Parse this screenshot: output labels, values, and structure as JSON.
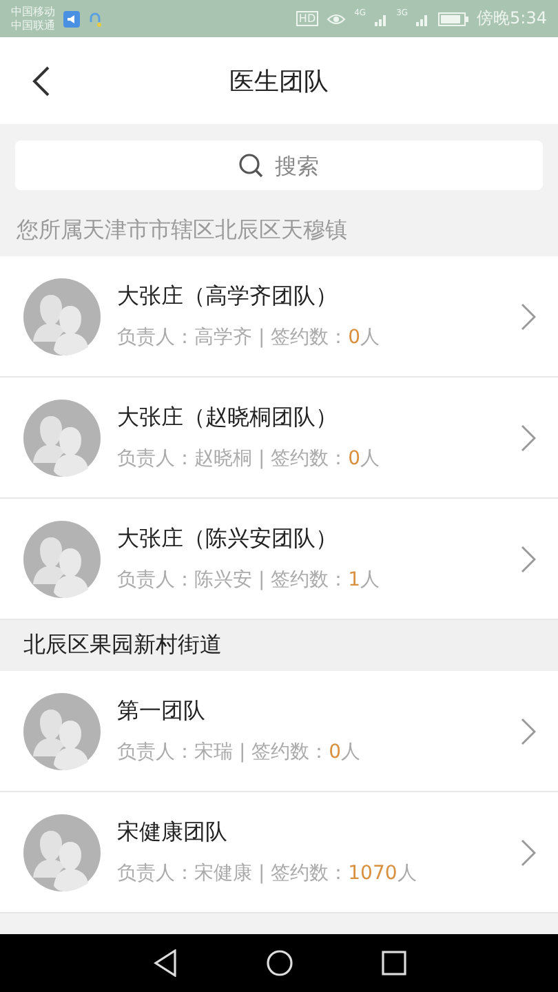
{
  "status_bar": {
    "carriers": [
      "中国移动",
      "中国联通"
    ],
    "hd": "HD",
    "network_1": "4G",
    "network_2": "3G",
    "time": "傍晚5:34"
  },
  "header": {
    "title": "医生团队"
  },
  "search": {
    "placeholder": "搜索"
  },
  "sections": [
    {
      "kind": "location",
      "title": "您所属天津市市辖区北辰区天穆镇",
      "teams": [
        {
          "name": "大张庄（高学齐团队）",
          "info": "负责人：高学齐 | 签约数：",
          "count": "0",
          "unit": "人"
        },
        {
          "name": "大张庄（赵晓桐团队）",
          "info": "负责人：赵晓桐 | 签约数：",
          "count": "0",
          "unit": "人"
        },
        {
          "name": "大张庄（陈兴安团队）",
          "info": "负责人：陈兴安 | 签约数：",
          "count": "1",
          "unit": "人"
        }
      ]
    },
    {
      "kind": "street",
      "title": "北辰区果园新村街道",
      "teams": [
        {
          "name": "第一团队",
          "info": "负责人：宋瑞 | 签约数：",
          "count": "0",
          "unit": "人"
        },
        {
          "name": "宋健康团队",
          "info": "负责人：宋健康 | 签约数：",
          "count": "1070",
          "unit": "人"
        }
      ]
    }
  ]
}
